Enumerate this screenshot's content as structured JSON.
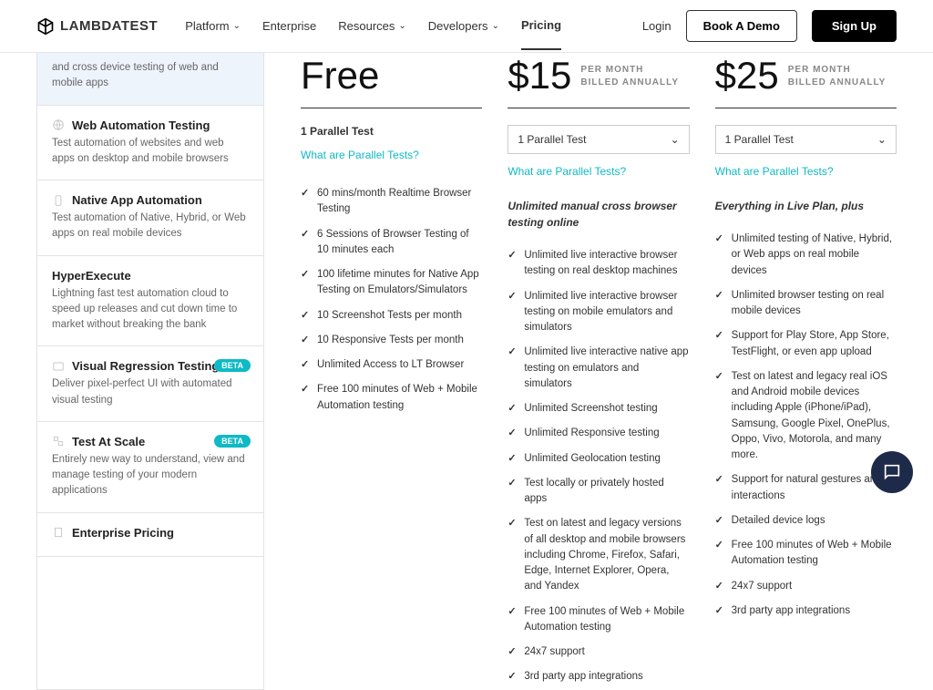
{
  "header": {
    "logo_text": "LAMBDATEST",
    "nav": {
      "platform": "Platform",
      "enterprise": "Enterprise",
      "resources": "Resources",
      "developers": "Developers",
      "pricing": "Pricing"
    },
    "login": "Login",
    "book_demo": "Book A Demo",
    "sign_up": "Sign Up"
  },
  "sidebar": {
    "cross_desc": "and cross device testing of web and mobile apps",
    "web_auto_title": "Web Automation Testing",
    "web_auto_desc": "Test automation of websites and web apps on desktop and mobile browsers",
    "native_title": "Native App Automation",
    "native_desc": "Test automation of Native, Hybrid, or Web apps on real mobile devices",
    "hyper_title": "HyperExecute",
    "hyper_desc": "Lightning fast test automation cloud to speed up releases and cut down time to market without breaking the bank",
    "visual_title": "Visual Regression Testing",
    "visual_desc": "Deliver pixel-perfect UI with automated visual testing",
    "scale_title": "Test At Scale",
    "scale_desc": "Entirely new way to understand, view and manage testing of your modern applications",
    "enterprise_title": "Enterprise Pricing",
    "beta_label": "BETA"
  },
  "plans": {
    "what_link": "What are Parallel Tests?",
    "parallel_text": "1 Parallel Test",
    "free": {
      "price": "Free",
      "features": [
        "60 mins/month Realtime Browser Testing",
        "6 Sessions of Browser Testing of 10 minutes each",
        "100 lifetime minutes for Native App Testing on Emulators/Simulators",
        "10 Screenshot Tests per month",
        "10 Responsive Tests per month",
        "Unlimited Access to LT Browser",
        "Free 100 minutes of Web + Mobile Automation testing"
      ]
    },
    "p15": {
      "price": "$15",
      "sub1": "PER MONTH",
      "sub2": "BILLED ANNUALLY",
      "headline": "Unlimited manual cross browser testing online",
      "features": [
        "Unlimited live interactive browser testing on real desktop machines",
        "Unlimited live interactive browser testing on mobile emulators and simulators",
        "Unlimited live interactive native app testing on emulators and simulators",
        "Unlimited Screenshot testing",
        "Unlimited Responsive testing",
        "Unlimited Geolocation testing",
        "Test locally or privately hosted apps",
        "Test on latest and legacy versions of all desktop and mobile browsers including Chrome, Firefox, Safari, Edge, Internet Explorer, Opera, and Yandex",
        "Free 100 minutes of Web + Mobile Automation testing",
        "24x7 support",
        "3rd party app integrations"
      ]
    },
    "p25": {
      "price": "$25",
      "sub1": "PER MONTH",
      "sub2": "BILLED ANNUALLY",
      "headline": "Everything in Live Plan, plus",
      "features": [
        "Unlimited testing of Native, Hybrid, or Web apps on real mobile devices",
        "Unlimited browser testing on real mobile devices",
        "Support for Play Store, App Store, TestFlight, or even app upload",
        "Test on latest and legacy real iOS and Android mobile devices including Apple (iPhone/iPad), Samsung, Google Pixel, OnePlus, Oppo, Vivo, Motorola, and many more.",
        "Support for natural gestures and interactions",
        "Detailed device logs",
        "Free 100 minutes of Web + Mobile Automation testing",
        "24x7 support",
        "3rd party app integrations"
      ]
    }
  }
}
